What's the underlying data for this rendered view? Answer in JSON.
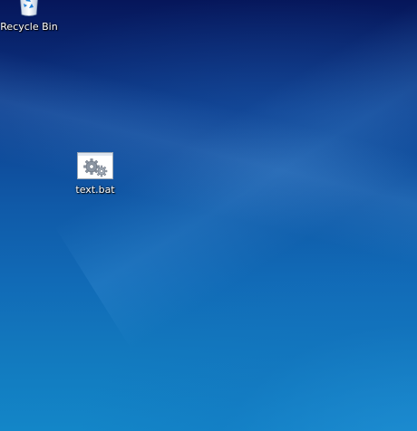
{
  "desktop": {
    "icons": [
      {
        "label": "Recycle Bin",
        "icon": "recycle-bin-icon"
      },
      {
        "label": "text.bat",
        "icon": "batch-file-icon"
      }
    ],
    "colors": {
      "wallpaper_top": "#06165a",
      "wallpaper_bottom": "#1386c8",
      "label_text": "#ffffff"
    }
  }
}
